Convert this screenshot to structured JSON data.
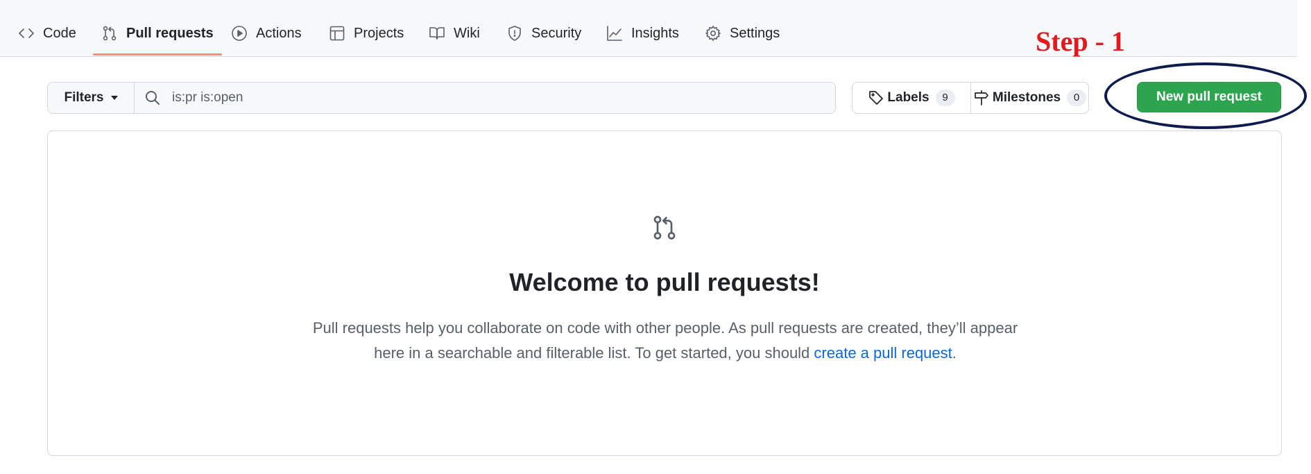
{
  "nav": {
    "items": [
      {
        "label": "Code",
        "icon": "code-icon"
      },
      {
        "label": "Pull requests",
        "icon": "git-pull-request-icon",
        "active": true
      },
      {
        "label": "Actions",
        "icon": "play-icon"
      },
      {
        "label": "Projects",
        "icon": "table-icon"
      },
      {
        "label": "Wiki",
        "icon": "book-icon"
      },
      {
        "label": "Security",
        "icon": "shield-icon"
      },
      {
        "label": "Insights",
        "icon": "graph-icon"
      },
      {
        "label": "Settings",
        "icon": "gear-icon"
      }
    ]
  },
  "annotation": {
    "step_label": "Step - 1",
    "color": "#e5181e",
    "ellipse_color": "#0d1b4f"
  },
  "filter_bar": {
    "filters_label": "Filters",
    "search_value": "is:pr is:open"
  },
  "labels": {
    "label": "Labels",
    "count": "9"
  },
  "milestones": {
    "label": "Milestones",
    "count": "0"
  },
  "new_pr": {
    "label": "New pull request",
    "color": "#2da44e"
  },
  "blankslate": {
    "icon": "git-pull-request-icon",
    "title": "Welcome to pull requests!",
    "text_part1": "Pull requests help you collaborate on code with other people. As pull requests are created, they’ll appear here in a searchable and filterable list. To get started, you should ",
    "link_text": "create a pull request",
    "text_part2": "."
  },
  "colors": {
    "link": "#0969da",
    "active_tab_underline": "#fd8c73"
  }
}
